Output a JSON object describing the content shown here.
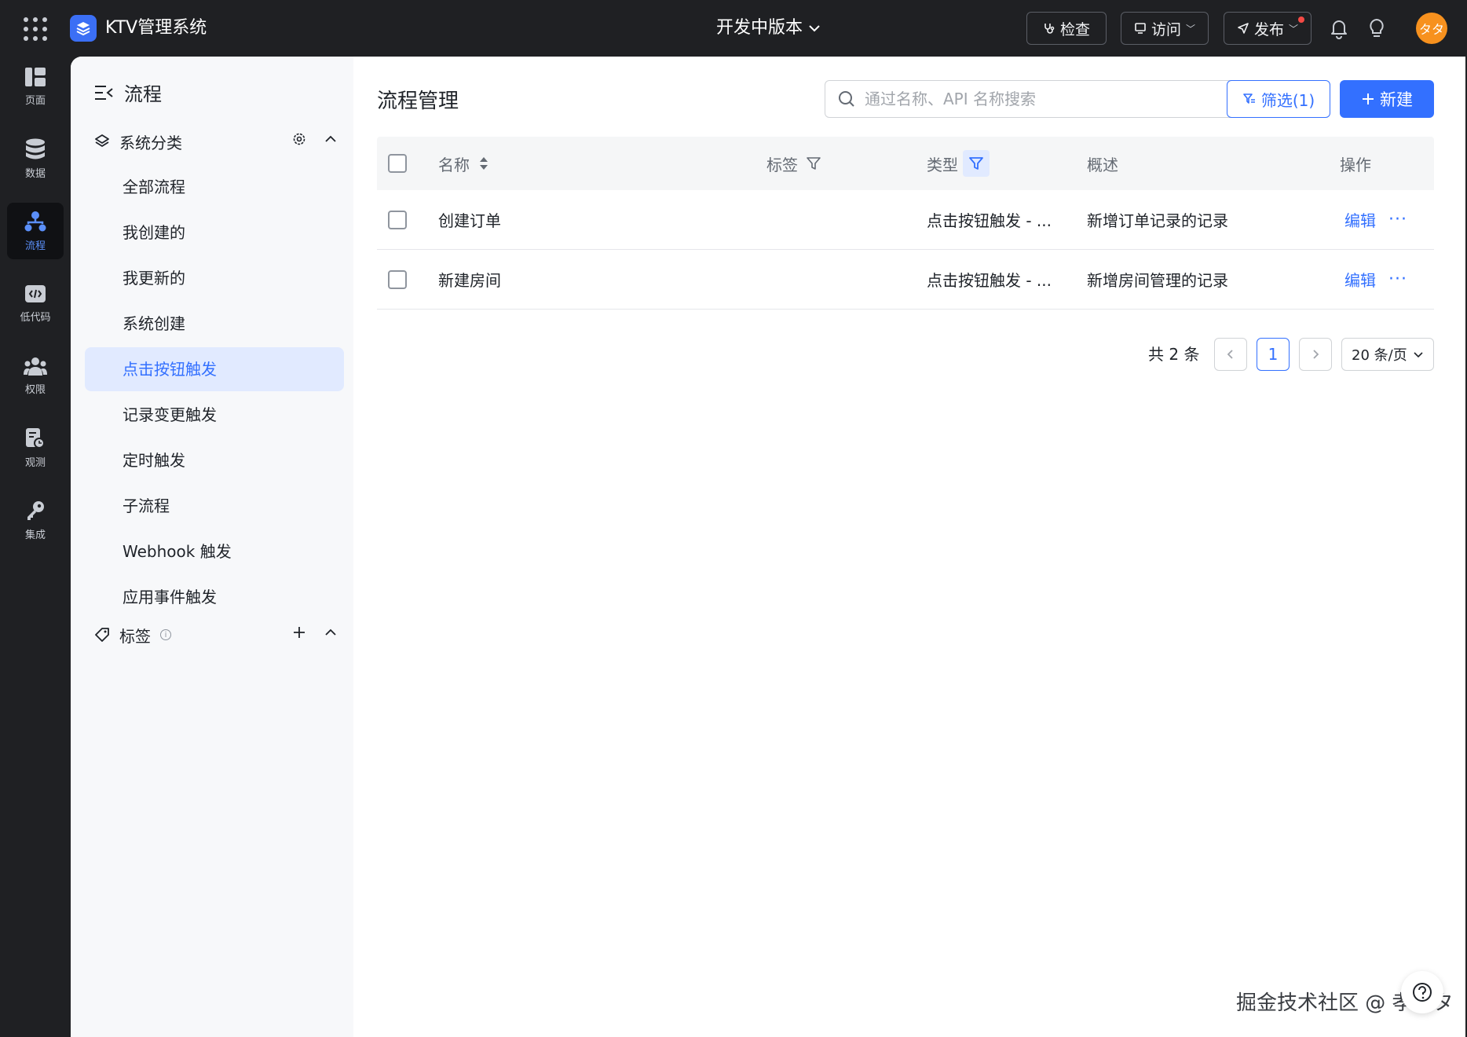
{
  "topbar": {
    "app_name": "KTV管理系统",
    "version": "开发中版本",
    "check_label": "检查",
    "visit_label": "访问",
    "publish_label": "发布",
    "avatar_text": "タタ",
    "avatar_color": "#f7911e",
    "logo_color": "#3b6ff5"
  },
  "rail": {
    "items": [
      {
        "label": "页面",
        "icon": "pages-icon"
      },
      {
        "label": "数据",
        "icon": "database-icon"
      },
      {
        "label": "流程",
        "icon": "flow-icon",
        "active": true
      },
      {
        "label": "低代码",
        "icon": "code-icon"
      },
      {
        "label": "权限",
        "icon": "users-icon"
      },
      {
        "label": "观测",
        "icon": "monitor-icon"
      },
      {
        "label": "集成",
        "icon": "key-icon"
      }
    ]
  },
  "sidebar": {
    "title": "流程",
    "group_label": "系统分类",
    "items": [
      "全部流程",
      "我创建的",
      "我更新的",
      "系统创建",
      "点击按钮触发",
      "记录变更触发",
      "定时触发",
      "子流程",
      "Webhook 触发",
      "应用事件触发"
    ],
    "active_item": "点击按钮触发",
    "tags_label": "标签"
  },
  "main": {
    "page_title": "流程管理",
    "search_placeholder": "通过名称、API 名称搜索",
    "filter_label": "筛选(1)",
    "new_label": "新建",
    "accent_color": "#3370ff"
  },
  "table": {
    "columns": {
      "name": "名称",
      "tag": "标签",
      "type": "类型",
      "desc": "概述",
      "ops": "操作"
    },
    "rows": [
      {
        "name": "创建订单",
        "tag": "",
        "type": "点击按钮触发 - ...",
        "desc": "新增订单记录的记录",
        "edit": "编辑",
        "more": "···"
      },
      {
        "name": "新建房间",
        "tag": "",
        "type": "点击按钮触发 - ...",
        "desc": "新增房间管理的记录",
        "edit": "编辑",
        "more": "···"
      }
    ]
  },
  "pagination": {
    "total": "共 2 条",
    "current_page": "1",
    "page_size": "20 条/页"
  },
  "watermark": "掘金技术社区 @ 孝タタ"
}
